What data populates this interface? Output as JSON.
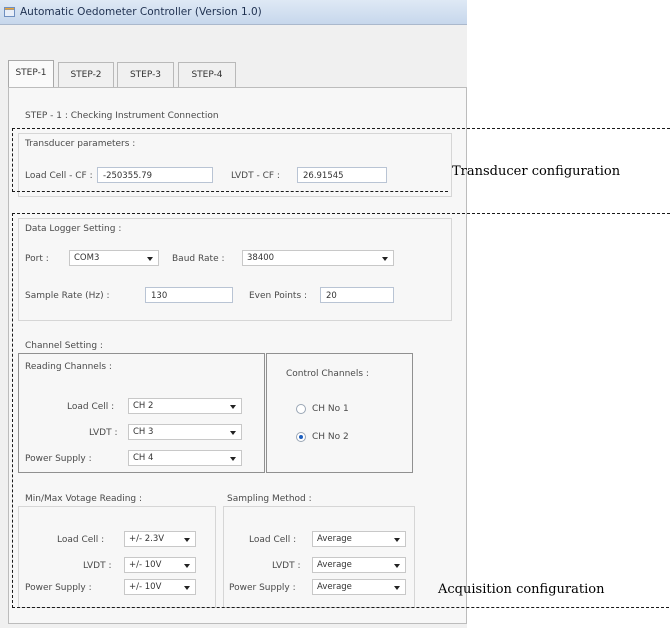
{
  "window": {
    "title": "Automatic Oedometer Controller (Version 1.0)",
    "icon": "app-window-icon"
  },
  "tabs": [
    {
      "label": "STEP-1",
      "active": true
    },
    {
      "label": "STEP-2",
      "active": false
    },
    {
      "label": "STEP-3",
      "active": false
    },
    {
      "label": "STEP-4",
      "active": false
    }
  ],
  "step_heading": "STEP - 1 : Checking Instrument Connection",
  "transducer": {
    "group_label": "Transducer parameters :",
    "loadcell_cf_label": "Load Cell - CF :",
    "loadcell_cf_value": "-250355.79",
    "lvdt_cf_label": "LVDT - CF :",
    "lvdt_cf_value": "26.91545"
  },
  "logger": {
    "group_label": "Data Logger Setting :",
    "port_label": "Port :",
    "port_value": "COM3",
    "baud_label": "Baud Rate :",
    "baud_value": "38400",
    "sample_rate_label": "Sample Rate (Hz) :",
    "sample_rate_value": "130",
    "even_points_label": "Even Points :",
    "even_points_value": "20"
  },
  "channel": {
    "group_label": "Channel Setting :",
    "reading_label": "Reading Channels :",
    "load_cell_label": "Load Cell :",
    "load_cell_value": "CH 2",
    "lvdt_label": "LVDT :",
    "lvdt_value": "CH 3",
    "power_label": "Power Supply :",
    "power_value": "CH 4",
    "control_label": "Control Channels :",
    "control_options": [
      {
        "label": "CH No 1",
        "checked": false
      },
      {
        "label": "CH No 2",
        "checked": true
      }
    ]
  },
  "voltage": {
    "group_label": "Min/Max Votage Reading :",
    "load_cell_label": "Load Cell :",
    "load_cell_value": "+/- 2.3V",
    "lvdt_label": "LVDT :",
    "lvdt_value": "+/- 10V",
    "power_label": "Power Supply :",
    "power_value": "+/- 10V"
  },
  "sampling": {
    "group_label": "Sampling Method :",
    "load_cell_label": "Load Cell :",
    "load_cell_value": "Average",
    "lvdt_label": "LVDT :",
    "lvdt_value": "Average",
    "power_label": "Power Supply :",
    "power_value": "Average"
  },
  "annotations": {
    "transducer_config": "Transducer configuration",
    "acquisition_config": "Acquisition configuration"
  }
}
